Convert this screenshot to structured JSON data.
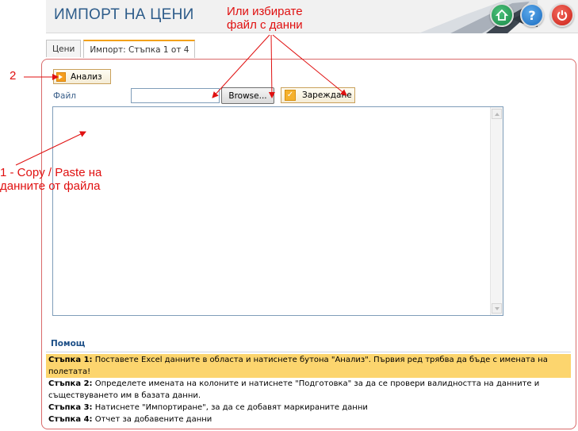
{
  "header": {
    "title": "ИМПОРТ НА ЦЕНИ",
    "buttons": [
      "home-icon",
      "help-icon",
      "power-icon"
    ],
    "help_glyph": "?"
  },
  "tabs": [
    {
      "label": "Цени",
      "active": false
    },
    {
      "label": "Импорт: Стъпка 1 от 4",
      "active": true
    }
  ],
  "toolbar": {
    "analyze_label": "Анализ",
    "file_label": "Файл",
    "file_value": "",
    "browse_label": "Browse...",
    "load_label": "Зареждане"
  },
  "editor": {
    "value": ""
  },
  "help": {
    "title": "Помощ",
    "steps": [
      {
        "label": "Стъпка 1:",
        "text": " Поставете Excel данните в областа и натиснете бутона \"Анализ\". Първия ред трябва да бъде с имената на полетата!",
        "highlight": true
      },
      {
        "label": "Стъпка 2:",
        "text": " Определете имената на колоните и натиснете \"Подготовка\" за да се провери валидността на данните и съществуването им в базата данни.",
        "highlight": false
      },
      {
        "label": "Стъпка 3:",
        "text": " Натиснете \"Импортиране\", за да се добавят маркираните данни",
        "highlight": false
      },
      {
        "label": "Стъпка 4:",
        "text": " Отчет за добавените данни",
        "highlight": false
      }
    ]
  },
  "annotations": {
    "top_line1": "Или избирате",
    "top_line2": "файл с данни",
    "num2": "2",
    "step1_line1": "1 -  Copy / Paste на",
    "step1_line2": "данните от файла"
  },
  "colors": {
    "annotation": "#e01010",
    "title": "#2d5c8a",
    "tab_accent": "#f2a11a",
    "highlight": "#fcd56e"
  }
}
